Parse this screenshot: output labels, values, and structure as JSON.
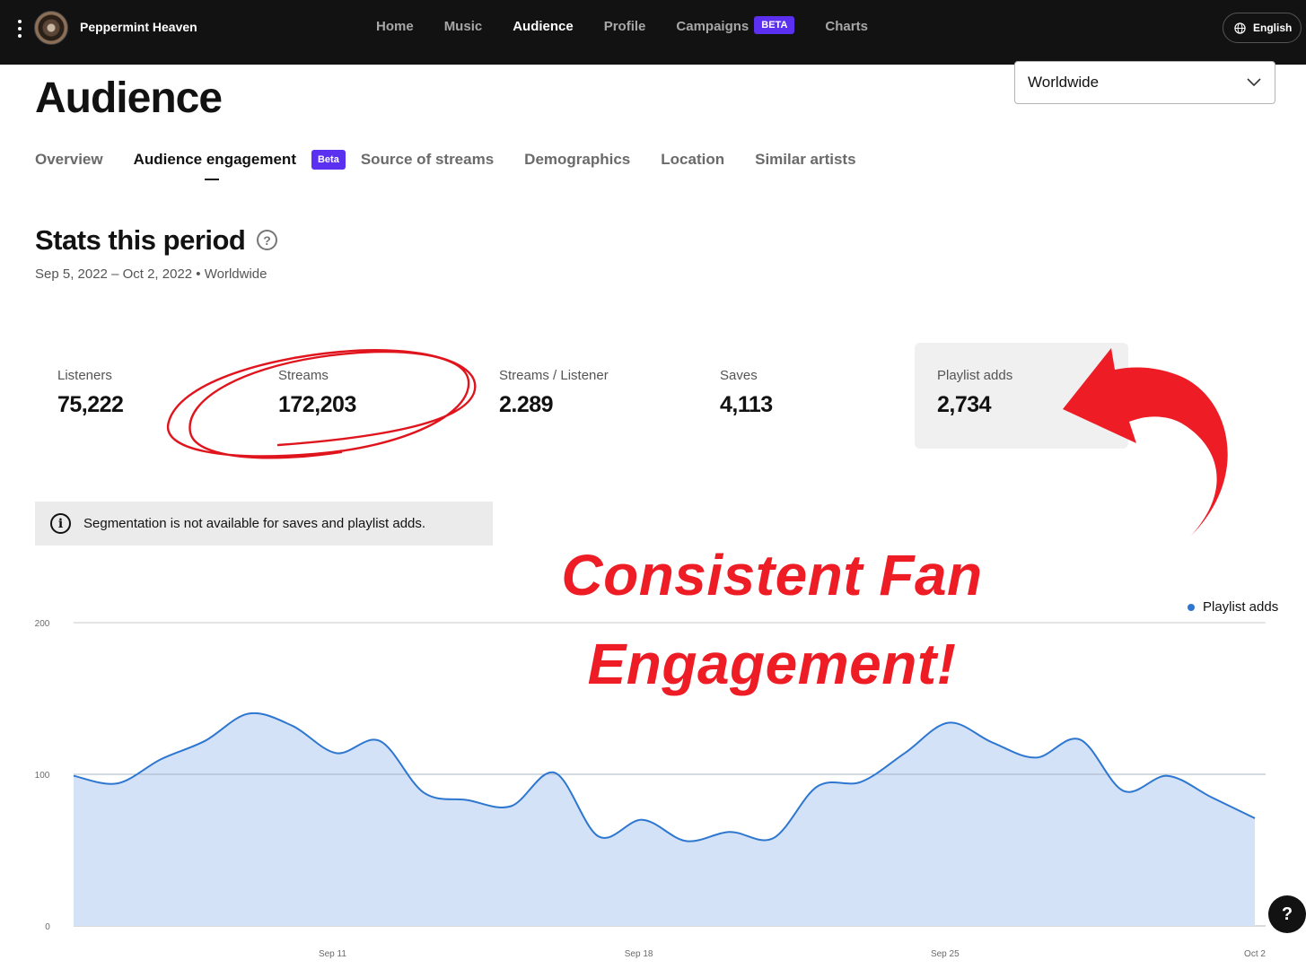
{
  "app": {
    "artist_name": "Peppermint Heaven",
    "language": "English"
  },
  "nav": {
    "items": [
      {
        "label": "Home"
      },
      {
        "label": "Music"
      },
      {
        "label": "Audience",
        "active": true
      },
      {
        "label": "Profile"
      },
      {
        "label": "Campaigns",
        "badge": "BETA"
      },
      {
        "label": "Charts"
      }
    ]
  },
  "page": {
    "title": "Audience",
    "region": "Worldwide"
  },
  "tabs": {
    "overview": "Overview",
    "engagement": "Audience engagement",
    "engagement_badge": "Beta",
    "source": "Source of streams",
    "demographics": "Demographics",
    "location": "Location",
    "similar": "Similar artists"
  },
  "stats": {
    "title": "Stats this period",
    "period": "Sep 5, 2022 – Oct 2, 2022 • Worldwide",
    "items": [
      {
        "label": "Listeners",
        "value": "75,222"
      },
      {
        "label": "Streams",
        "value": "172,203"
      },
      {
        "label": "Streams / Listener",
        "value": "2.289"
      },
      {
        "label": "Saves",
        "value": "4,113"
      },
      {
        "label": "Playlist adds",
        "value": "2,734"
      }
    ]
  },
  "info_banner": "Segmentation is not available for saves and playlist adds.",
  "annotation": {
    "line1": "Consistent Fan",
    "line2": "Engagement!",
    "color": "#ee1c25"
  },
  "help_button": "?",
  "colors": {
    "brand_purple": "#5b30f0",
    "series_line": "#2e77d0",
    "series_fill": "#d4e2f8"
  },
  "chart_data": {
    "type": "area",
    "y_ticks": [
      "200",
      "100",
      "0"
    ],
    "ylim": [
      0,
      200
    ],
    "x_tick_labels": [
      "Sep 11",
      "Sep 18",
      "Sep 25",
      "Oct 2"
    ],
    "grid": true,
    "legend_position": "top-right",
    "series": [
      {
        "name": "Playlist adds",
        "x": [
          "Sep 5",
          "Sep 6",
          "Sep 7",
          "Sep 8",
          "Sep 9",
          "Sep 10",
          "Sep 11",
          "Sep 12",
          "Sep 13",
          "Sep 14",
          "Sep 15",
          "Sep 16",
          "Sep 17",
          "Sep 18",
          "Sep 19",
          "Sep 20",
          "Sep 21",
          "Sep 22",
          "Sep 23",
          "Sep 24",
          "Sep 25",
          "Sep 26",
          "Sep 27",
          "Sep 28",
          "Sep 29",
          "Sep 30",
          "Oct 1",
          "Oct 2"
        ],
        "values": [
          99,
          94,
          110,
          122,
          140,
          132,
          114,
          122,
          88,
          83,
          79,
          101,
          59,
          70,
          56,
          62,
          58,
          92,
          95,
          114,
          134,
          121,
          111,
          123,
          89,
          99,
          85,
          71
        ]
      }
    ]
  }
}
